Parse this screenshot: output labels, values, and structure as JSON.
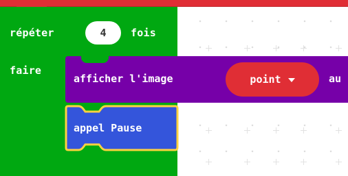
{
  "repeat_block": {
    "label_repeat": "répéter",
    "count": "4",
    "label_times": "fois",
    "label_do": "faire"
  },
  "show_image_block": {
    "label": "afficher l'image",
    "image_value": "point",
    "suffix": "au"
  },
  "call_block": {
    "label": "appel Pause"
  },
  "colors": {
    "loops_green": "#00a811",
    "images_purple": "#7600a8",
    "dropdown_red": "#e02e35",
    "functions_blue": "#3455db",
    "selection_yellow": "#ffd23f"
  },
  "icons": {
    "dropdown": "caret-down-icon"
  }
}
